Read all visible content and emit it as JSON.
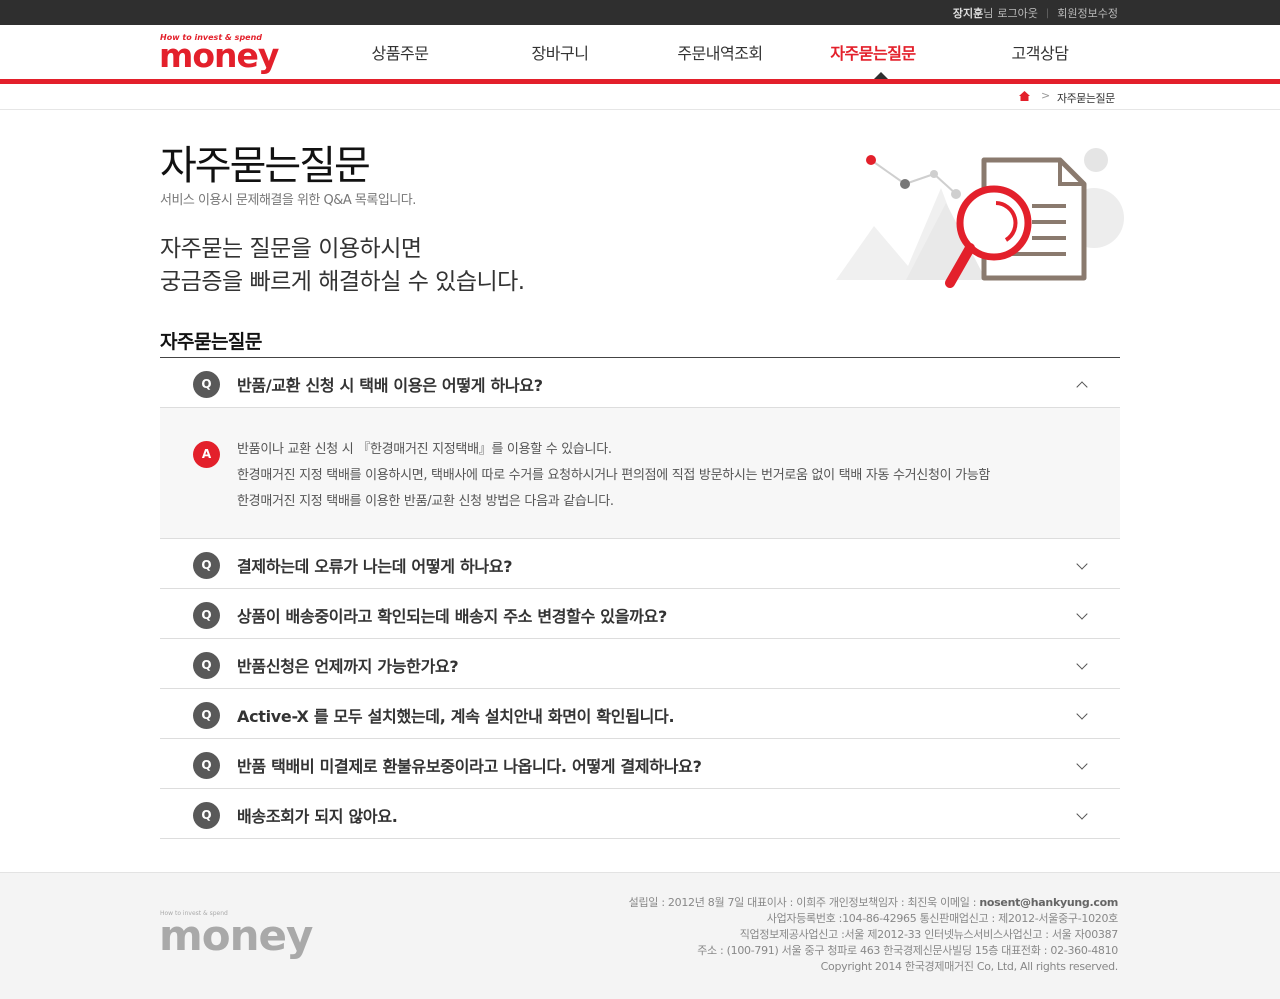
{
  "topbar": {
    "user_name": "장지훈",
    "user_suffix": "님",
    "logout": "로그아웃",
    "edit_profile": "회원정보수정"
  },
  "logo": {
    "tagline": "How to invest & spend",
    "word": "money"
  },
  "nav": {
    "items": [
      "상품주문",
      "장바구니",
      "주문내역조회",
      "자주묻는질문",
      "고객상담"
    ],
    "active_index": 3
  },
  "breadcrumb": {
    "current": "자주묻는질문"
  },
  "page": {
    "title": "자주묻는질문",
    "subtitle": "서비스 이용시 문제해결을 위한 Q&A 목록입니다.",
    "intro_line1": "자주묻는 질문을 이용하시면",
    "intro_line2": "궁금증을 빠르게 해결하실 수 있습니다."
  },
  "faq": {
    "heading": "자주묻는질문",
    "q_badge": "Q",
    "a_badge": "A",
    "items": [
      {
        "question": "반품/교환 신청 시 택배 이용은 어떻게 하나요?",
        "expanded": true,
        "answer": [
          "반품이나 교환 신청 시 『한경매거진 지정택배』를 이용할 수 있습니다.",
          "한경매거진 지정 택배를 이용하시면, 택배사에 따로 수거를 요청하시거나 편의점에 직접 방문하시는 번거로움 없이 택배 자동 수거신청이 가능함",
          "한경매거진 지정 택배를 이용한 반품/교환 신청 방법은 다음과 같습니다."
        ]
      },
      {
        "question": "결제하는데 오류가 나는데 어떻게 하나요?",
        "expanded": false
      },
      {
        "question": "상품이 배송중이라고 확인되는데 배송지 주소 변경할수 있을까요?",
        "expanded": false
      },
      {
        "question": "반품신청은 언제까지 가능한가요?",
        "expanded": false
      },
      {
        "question": "Active-X 를 모두 설치했는데, 계속 설치안내 화면이 확인됩니다.",
        "expanded": false
      },
      {
        "question": "반품 택배비 미결제로 환불유보중이라고 나옵니다. 어떻게 결제하나요?",
        "expanded": false
      },
      {
        "question": "배송조회가 되지 않아요.",
        "expanded": false
      }
    ]
  },
  "footer": {
    "logo_tagline": "How to invest & spend",
    "logo_word": "money",
    "line1_prefix": "설립일 : 2012년 8월 7일 대표이사 : 이희주 개인정보책임자 : 최진욱 이메일 : ",
    "email": "nosent@hankyung.com",
    "line2": "사업자등록번호 :104-86-42965 통신판매업신고 : 제2012-서울중구-1020호",
    "line3": "직업정보제공사업신고 :서울 제2012-33 인터넷뉴스서비스사업신고 : 서울 자00387",
    "line4": "주소 : (100-791) 서울 중구 청파로 463 한국경제신문사빌딩 15층 대표전화 : 02-360-4810",
    "line5": "Copyright 2014 한국경제매거진 Co, Ltd, All rights reserved."
  },
  "colors": {
    "accent": "#e3202b",
    "dark": "#2f2f2f",
    "badge": "#595959"
  }
}
